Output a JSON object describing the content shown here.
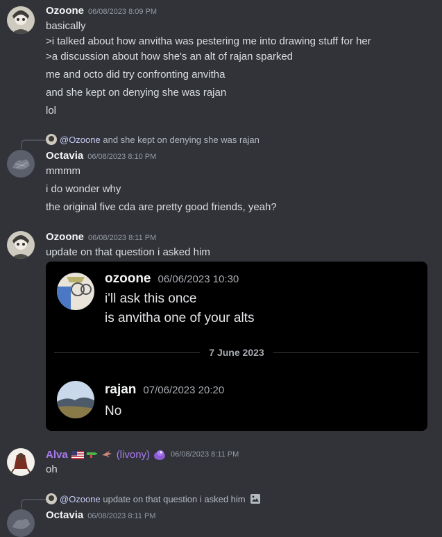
{
  "messages": [
    {
      "author": "Ozoone",
      "timestamp": "06/08/2023 8:09 PM",
      "lines": [
        "basically",
        ">i talked about how anvitha was pestering me into drawing stuff for her",
        ">a discussion about how she's an alt of rajan sparked",
        "me and octo did try confronting anvitha",
        "and she kept on denying she was rajan",
        "lol"
      ]
    },
    {
      "reply": {
        "mention": "@Ozoone",
        "text": "and she kept on denying she was rajan"
      },
      "author": "Octavia",
      "timestamp": "06/08/2023 8:10 PM",
      "lines": [
        "mmmm",
        "i do wonder why",
        "the original five cda are pretty good friends, yeah?"
      ]
    },
    {
      "author": "Ozoone",
      "timestamp": "06/08/2023 8:11 PM",
      "lines": [
        "update on that question i asked him"
      ],
      "embed": {
        "msg1": {
          "author": "ozoone",
          "timestamp": "06/06/2023 10:30",
          "lines": [
            "i'll ask this once",
            "is anvitha one of your alts"
          ]
        },
        "divider": "7 June 2023",
        "msg2": {
          "author": "rajan",
          "timestamp": "07/06/2023 20:20",
          "lines": [
            "No"
          ]
        }
      }
    },
    {
      "author": "Alva",
      "author_suffix": "(livony)",
      "author_color": "#a97bf0",
      "timestamp": "06/08/2023 8:11 PM",
      "lines": [
        "oh"
      ]
    },
    {
      "reply": {
        "mention": "@Ozoone",
        "text": "update on that question i asked him"
      },
      "author": "Octavia",
      "timestamp": "06/08/2023 8:11 PM"
    }
  ],
  "icons": [
    "avatar-ozoone",
    "avatar-octavia",
    "avatar-alva",
    "us-flag-icon",
    "gun-icon",
    "bird-icon",
    "purple-blob-emoji-icon",
    "image-icon"
  ]
}
